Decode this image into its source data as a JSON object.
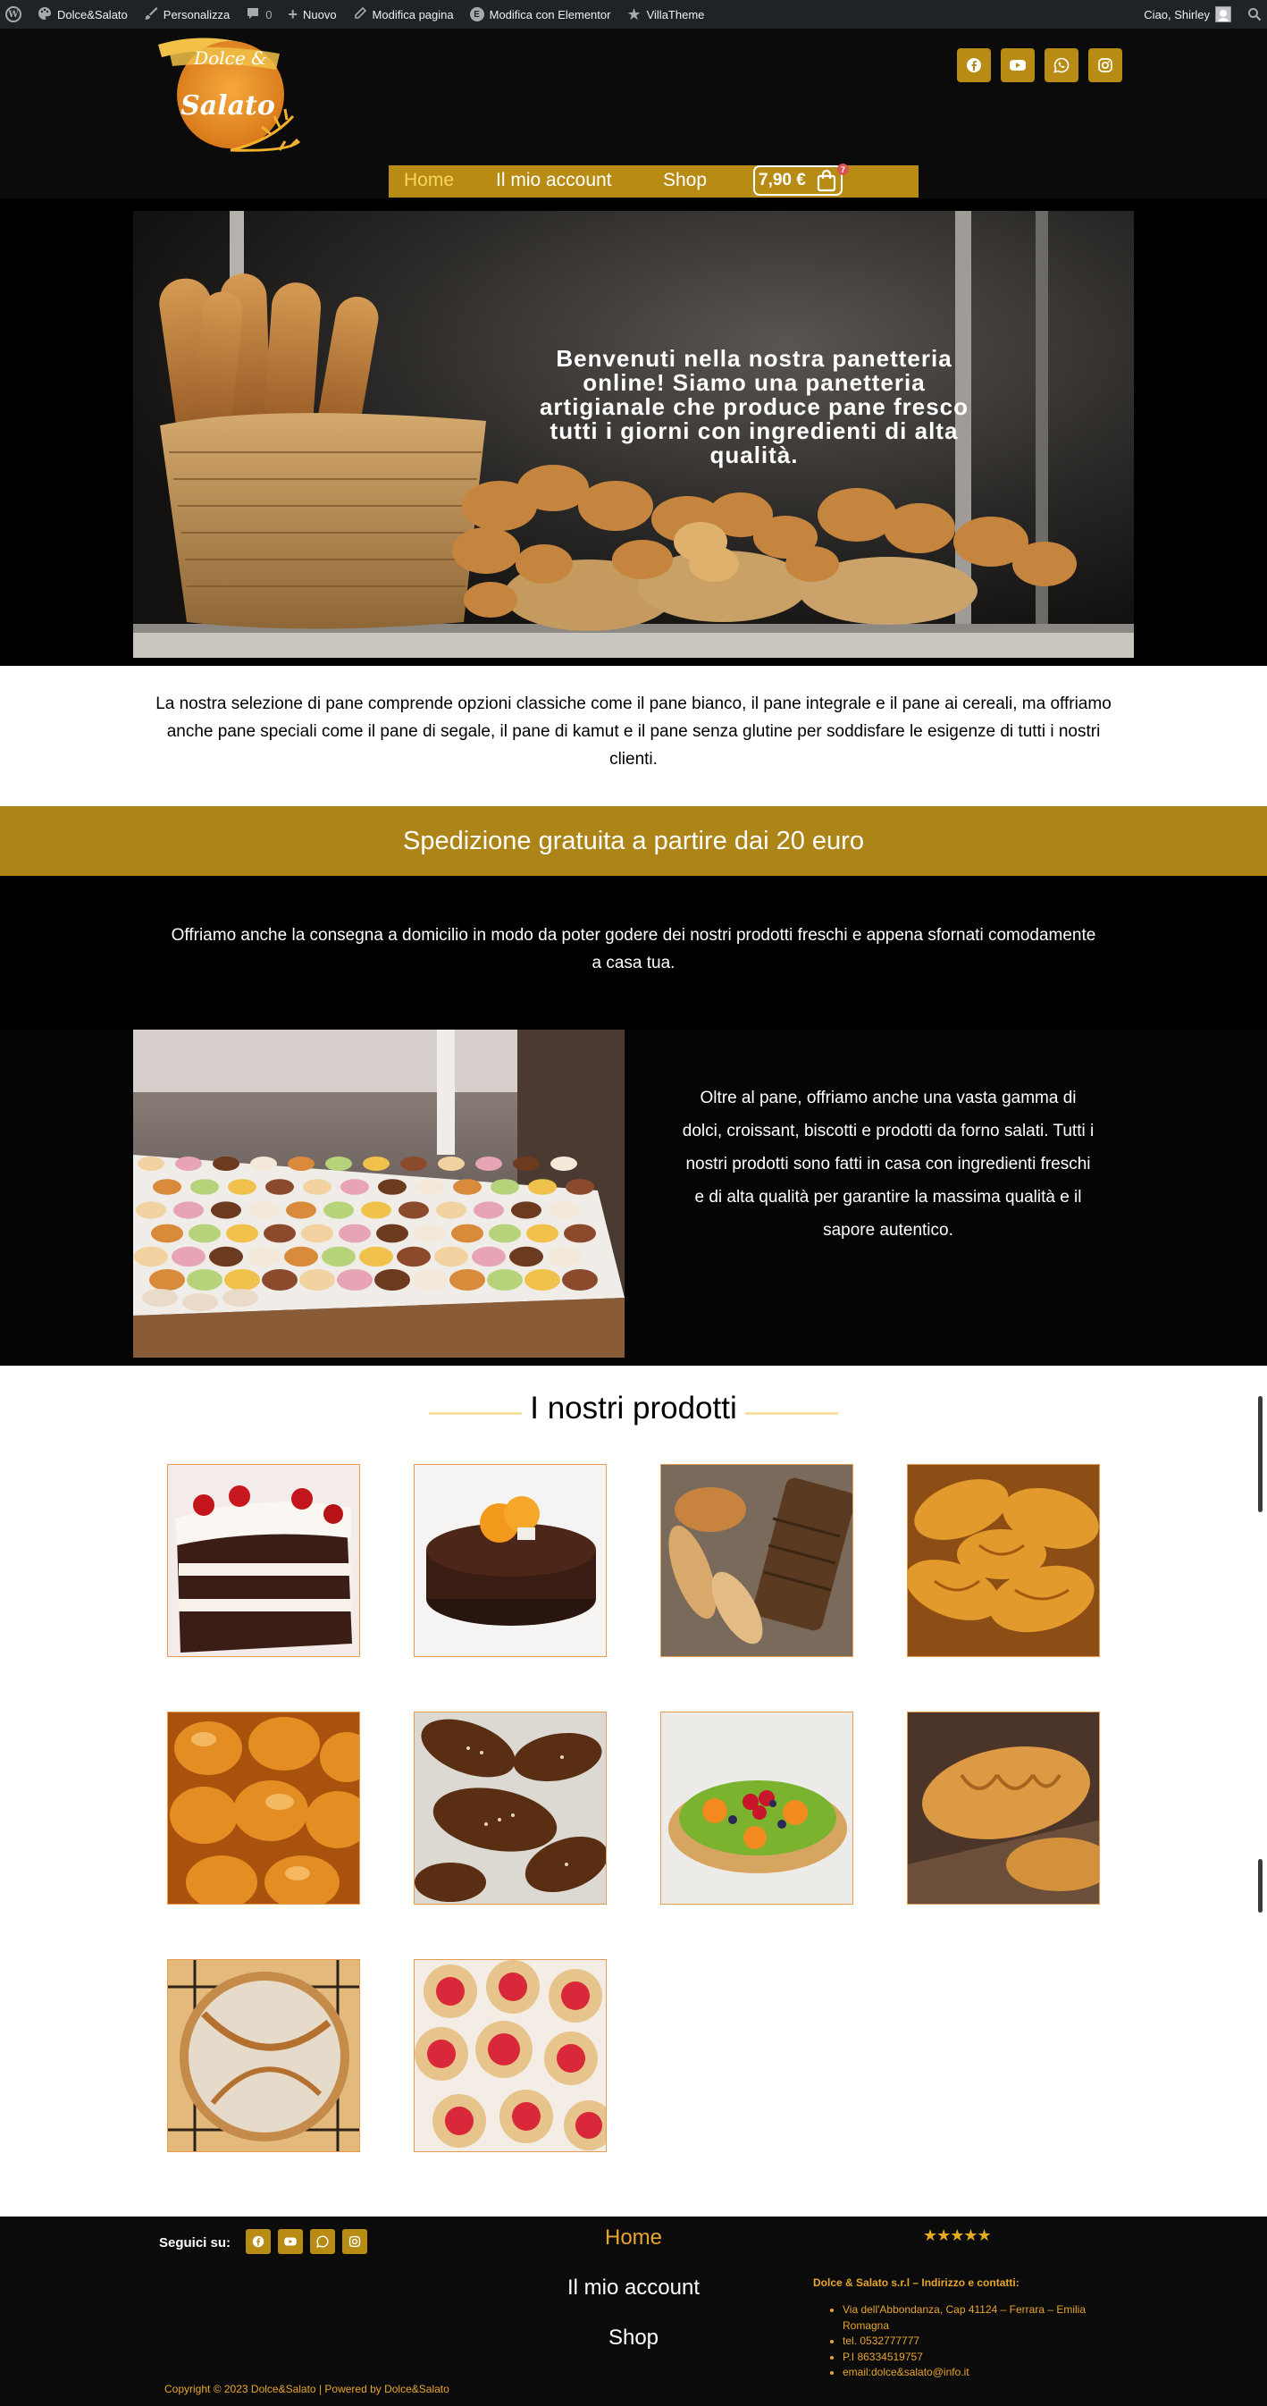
{
  "adminbar": {
    "site_name": "Dolce&Salato",
    "customize": "Personalizza",
    "comments_count": "0",
    "new": "Nuovo",
    "edit_page": "Modifica pagina",
    "edit_elementor": "Modifica con Elementor",
    "theme": "VillaTheme",
    "greeting": "Ciao, Shirley"
  },
  "header": {
    "logo_text_top": "Dolce &",
    "logo_text_bottom": "Salato",
    "nav": [
      "Home",
      "Il mio account",
      "Shop"
    ],
    "cart_total": "7,90 €",
    "cart_count": "7",
    "social": [
      "facebook-icon",
      "youtube-icon",
      "whatsapp-icon",
      "instagram-icon"
    ]
  },
  "hero": {
    "text": "Benvenuti nella nostra panetteria online! Siamo una panetteria artigianale che produce pane fresco tutti i giorni con ingredienti di alta qualità."
  },
  "intro": {
    "text": "La nostra selezione di pane comprende opzioni classiche come il pane bianco, il pane integrale e il pane ai cereali, ma offriamo anche pane speciali come il pane di segale, il pane di kamut e il pane senza glutine per soddisfare le esigenze di tutti i nostri clienti."
  },
  "shipping": {
    "text": "Spedizione gratuita a partire dai 20 euro"
  },
  "delivery": {
    "text": "Offriamo anche la consegna a domicilio in modo da poter godere dei nostri prodotti freschi e appena sfornati comodamente a casa tua."
  },
  "feature": {
    "text": "Oltre al pane, offriamo anche una vasta gamma di dolci, croissant, biscotti e prodotti da forno salati. Tutti i nostri prodotti sono fatti in casa con ingredienti freschi e di alta qualità per garantire la massima qualità e il sapore autentico."
  },
  "products": {
    "title": "I nostri prodotti",
    "items": [
      "black-forest-cake",
      "chocolate-orange-cake",
      "bread-loaves",
      "croissants",
      "brioche-buns",
      "sesame-pastries",
      "fruit-tart",
      "croissant",
      "rustic-bread",
      "jam-cookies"
    ]
  },
  "footer": {
    "follow": "Seguici su:",
    "nav": [
      "Home",
      "Il mio account",
      "Shop"
    ],
    "stars": "★★★★★",
    "company": "Dolce & Salato s.r.l – Indirizzo e contatti:",
    "contacts": [
      "Via dell'Abbondanza, Cap 41124 – Ferrara – Emilia Romagna",
      "tel. 0532777777",
      "P.I 86334519757",
      "email:dolce&salato@info.it"
    ],
    "copyright": "Copyright © 2023 Dolce&Salato | Powered by Dolce&Salato"
  },
  "colors": {
    "gold": "#b88b15",
    "ship_bar": "#ac8418",
    "footer_text": "#e8a52b",
    "nav_active": "#f7d65c"
  }
}
